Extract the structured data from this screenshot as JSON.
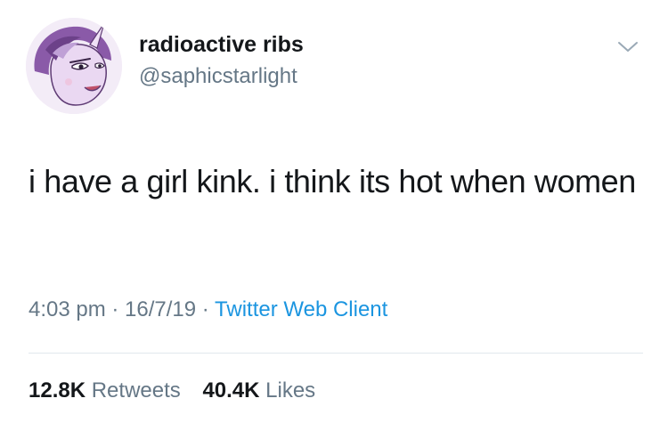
{
  "user": {
    "display_name": "radioactive ribs",
    "handle": "@saphicstarlight",
    "avatar_icon": "pony-avatar"
  },
  "tweet": {
    "text": "i have a girl kink. i think its hot when women"
  },
  "meta": {
    "time": "4:03 pm",
    "date": "16/7/19",
    "separator": " · ",
    "client": "Twitter Web Client"
  },
  "stats": {
    "retweets_count": "12.8K",
    "retweets_label": "Retweets",
    "likes_count": "40.4K",
    "likes_label": "Likes"
  },
  "colors": {
    "text": "#14171a",
    "secondary": "#657786",
    "link": "#1b95e0",
    "divider": "#e1e8ed"
  },
  "icons": {
    "menu": "chevron-down-icon"
  }
}
